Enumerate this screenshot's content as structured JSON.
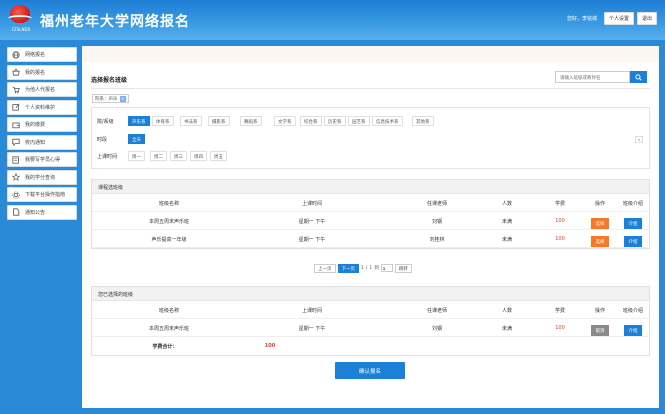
{
  "header": {
    "logo_text": "FZSLNDX",
    "title": "福州老年大学网络报名",
    "user_text": "您好，李铭城",
    "btn_profile": "个人设置",
    "btn_logout": "退出"
  },
  "sidebar": {
    "items": [
      {
        "label": "网络报名",
        "icon": "globe-icon"
      },
      {
        "label": "我的报名",
        "icon": "basket-icon"
      },
      {
        "label": "为他人代报名",
        "icon": "cart-icon"
      },
      {
        "label": "个人资料维护",
        "icon": "edit-icon"
      },
      {
        "label": "我的缴费",
        "icon": "wallet-icon"
      },
      {
        "label": "校内通知",
        "icon": "message-icon"
      },
      {
        "label": "我要写学员心得",
        "icon": "compose-icon"
      },
      {
        "label": "我的学分查询",
        "icon": "star-icon"
      },
      {
        "label": "下载平台操作指南",
        "icon": "gear-icon"
      },
      {
        "label": "通知公告",
        "icon": "doc-icon"
      }
    ]
  },
  "main": {
    "section_title": "选择报名班级",
    "search_placeholder": "请输入班级或教师名",
    "chip_label": "院系：声乐",
    "filters": {
      "dept_label": "院/系级",
      "dept_options": [
        "声乐系",
        "体育系",
        "书法系",
        "摄影系",
        "舞蹈系",
        "文学系",
        "综合系",
        "历史系",
        "园艺系",
        "信息技术系",
        "其他系"
      ],
      "time_label": "时段",
      "time_options": [
        "全天"
      ],
      "week_label": "上课时间",
      "week_options": [
        "周一",
        "周二",
        "周三",
        "周四",
        "周五"
      ],
      "collapse_label": "∧"
    },
    "available": {
      "title": "课程选班级",
      "columns": [
        "班级名称",
        "上课时间",
        "任课老师",
        "人数",
        "学费",
        "操作",
        "班级介绍"
      ],
      "rows": [
        {
          "name": "本周五周末声乐班",
          "time": "星期一 下午",
          "teacher": "刘钢",
          "count": "未满",
          "fee": "100",
          "action": "选择",
          "intro": "介绍"
        },
        {
          "name": "声乐提高一年级",
          "time": "星期一 下午",
          "teacher": "刘桂林",
          "count": "未满",
          "fee": "100",
          "action": "选择",
          "intro": "介绍"
        }
      ]
    },
    "pager": {
      "prev": "上一页",
      "next": "下一页",
      "current": "1",
      "sep": "/",
      "total": "1",
      "go_prefix": "到",
      "go_value": "1",
      "go_btn": "跳转"
    },
    "selected": {
      "title": "您已选择的班级",
      "columns": [
        "班级名称",
        "上课时间",
        "任课老师",
        "人数",
        "学费",
        "操作",
        "班级介绍"
      ],
      "rows": [
        {
          "name": "本周五周末声乐班",
          "time": "星期一 下午",
          "teacher": "刘钢",
          "count": "未满",
          "fee": "100",
          "action": "取消",
          "intro": "介绍"
        }
      ],
      "total_label": "学费合计：",
      "total_value": "100"
    },
    "submit": "确认报名"
  }
}
